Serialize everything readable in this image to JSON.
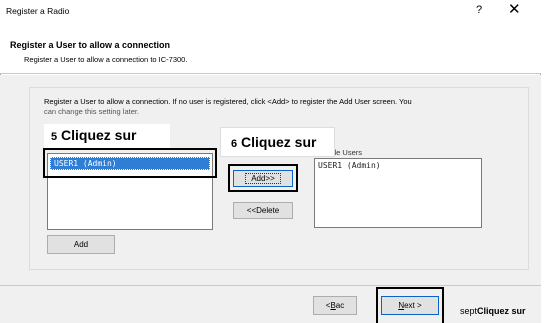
{
  "window": {
    "title": "Register a Radio",
    "help_glyph": "?",
    "close_glyph": "✕"
  },
  "header": {
    "title": "Register a User to allow a connection",
    "subtitle": "Register a User to allow a connection to IC-7300."
  },
  "content": {
    "description_line1": "Register a User to allow a connection. If no user is registered, click <Add> to register the Add User screen. You",
    "description_line2": "can change this setting later.",
    "available_users": [
      "USER1 (Admin)"
    ],
    "accessible_users_label_fragment": "essible Users",
    "accessible_users": [
      "USER1 (Admin)"
    ]
  },
  "buttons": {
    "add_mid": "Add>>",
    "delete": "<<Delete",
    "add_left": "Add",
    "back_prefix": "< ",
    "back_accel": "B",
    "back_rest": "ac",
    "next_accel": "N",
    "next_rest": "ext >"
  },
  "callouts": {
    "step5_num": "5",
    "step5_text": "Cliquez sur",
    "step6_num": "6",
    "step6_text": "Cliquez sur",
    "step7_num": "sept",
    "step7_text": "Cliquez sur"
  }
}
